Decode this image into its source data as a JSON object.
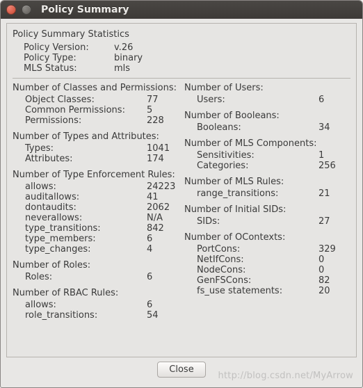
{
  "window": {
    "title": "Policy Summary",
    "close_button": "Close"
  },
  "header": {
    "title": "Policy Summary Statistics",
    "rows": [
      {
        "label": "Policy Version:",
        "value": "v.26"
      },
      {
        "label": "Policy Type:",
        "value": "binary"
      },
      {
        "label": "MLS Status:",
        "value": "mls"
      }
    ]
  },
  "left": [
    {
      "head": "Number of Classes and Permissions:",
      "rows": [
        {
          "label": "Object Classes:",
          "value": "77"
        },
        {
          "label": "Common Permissions:",
          "value": "5"
        },
        {
          "label": "Permissions:",
          "value": "228"
        }
      ]
    },
    {
      "head": "Number of Types and Attributes:",
      "rows": [
        {
          "label": "Types:",
          "value": "1041"
        },
        {
          "label": "Attributes:",
          "value": "174"
        }
      ]
    },
    {
      "head": "Number of Type Enforcement Rules:",
      "rows": [
        {
          "label": "allows:",
          "value": "24223"
        },
        {
          "label": "auditallows:",
          "value": "41"
        },
        {
          "label": "dontaudits:",
          "value": "2062"
        },
        {
          "label": "neverallows:",
          "value": "N/A"
        },
        {
          "label": "type_transitions:",
          "value": "842"
        },
        {
          "label": "type_members:",
          "value": "6"
        },
        {
          "label": "type_changes:",
          "value": "4"
        }
      ]
    },
    {
      "head": "Number of Roles:",
      "rows": [
        {
          "label": "Roles:",
          "value": "6"
        }
      ]
    },
    {
      "head": "Number of RBAC Rules:",
      "rows": [
        {
          "label": "allows:",
          "value": "6"
        },
        {
          "label": "role_transitions:",
          "value": "54"
        }
      ]
    }
  ],
  "right": [
    {
      "head": "Number of Users:",
      "rows": [
        {
          "label": "Users:",
          "value": "6"
        }
      ]
    },
    {
      "head": "Number of Booleans:",
      "rows": [
        {
          "label": "Booleans:",
          "value": "34"
        }
      ]
    },
    {
      "head": "Number of MLS Components:",
      "rows": [
        {
          "label": "Sensitivities:",
          "value": "1"
        },
        {
          "label": "Categories:",
          "value": "256"
        }
      ]
    },
    {
      "head": "Number of MLS Rules:",
      "rows": [
        {
          "label": "range_transitions:",
          "value": "21"
        }
      ]
    },
    {
      "head": "Number of Initial SIDs:",
      "rows": [
        {
          "label": "SIDs:",
          "value": "27"
        }
      ]
    },
    {
      "head": "Number of OContexts:",
      "rows": [
        {
          "label": "PortCons:",
          "value": "329"
        },
        {
          "label": "NetIfCons:",
          "value": "0"
        },
        {
          "label": "NodeCons:",
          "value": "0"
        },
        {
          "label": "GenFSCons:",
          "value": "82"
        },
        {
          "label": "fs_use statements:",
          "value": "20"
        }
      ]
    }
  ],
  "watermark": "http://blog.csdn.net/MyArrow"
}
